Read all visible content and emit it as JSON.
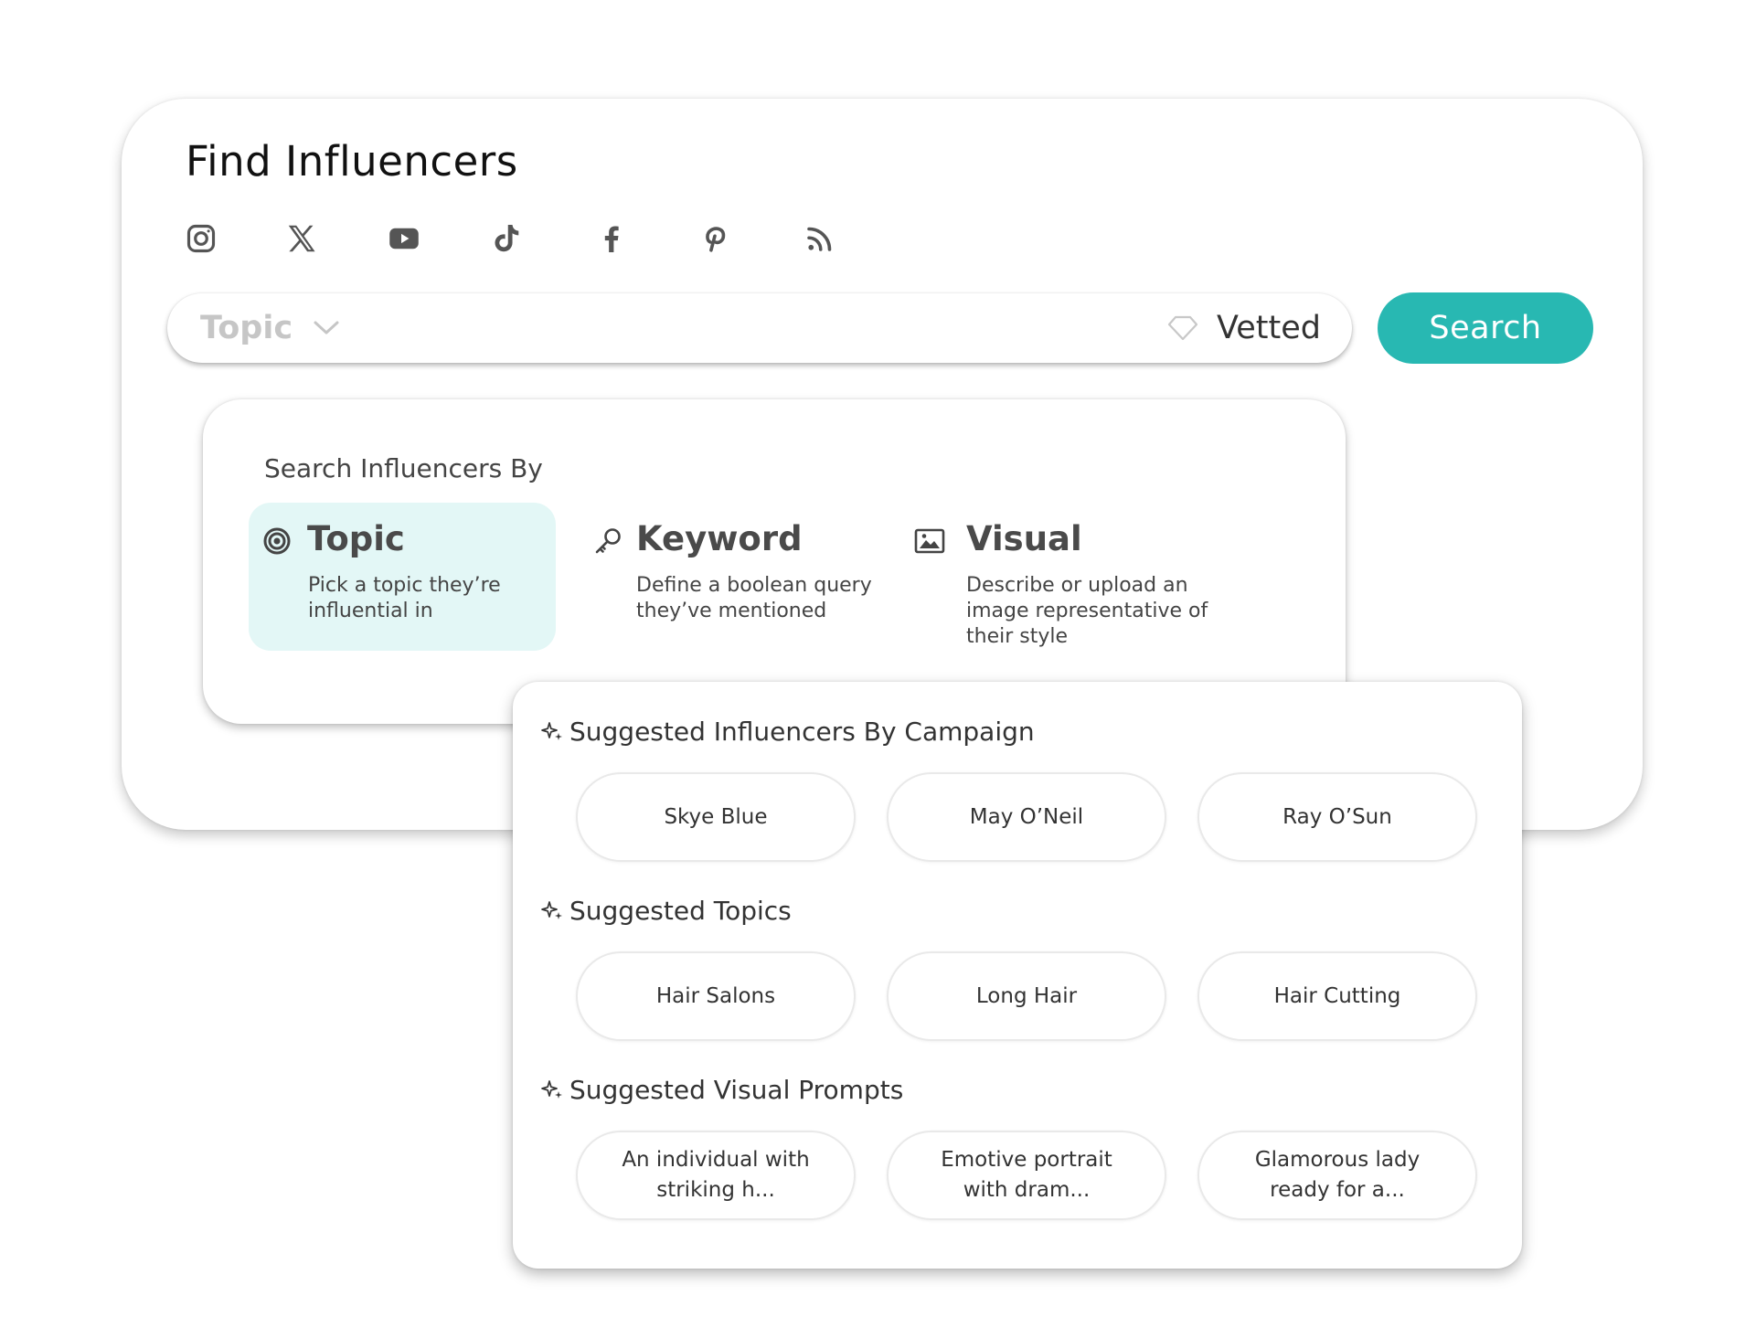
{
  "header": {
    "title": "Find Influencers"
  },
  "platforms": [
    {
      "name": "instagram-icon"
    },
    {
      "name": "x-icon"
    },
    {
      "name": "youtube-icon"
    },
    {
      "name": "tiktok-icon"
    },
    {
      "name": "facebook-icon"
    },
    {
      "name": "pinterest-icon"
    },
    {
      "name": "rss-icon"
    }
  ],
  "search": {
    "mode_label": "Topic",
    "vetted_label": "Vetted",
    "button_label": "Search"
  },
  "search_by": {
    "title": "Search Influencers By",
    "modes": [
      {
        "name": "Topic",
        "desc": "Pick a topic they’re influential in",
        "icon": "target-icon",
        "active": true
      },
      {
        "name": "Keyword",
        "desc": "Define a boolean query they’ve mentioned",
        "icon": "key-icon",
        "active": false
      },
      {
        "name": "Visual",
        "desc": "Describe or upload an image representative of their style",
        "icon": "image-icon",
        "active": false
      }
    ]
  },
  "suggestions": {
    "sections": [
      {
        "title": "Suggested Influencers By Campaign",
        "items": [
          "Skye Blue",
          "May O’Neil",
          "Ray O’Sun"
        ]
      },
      {
        "title": "Suggested Topics",
        "items": [
          "Hair Salons",
          "Long Hair",
          "Hair Cutting"
        ]
      },
      {
        "title": "Suggested Visual Prompts",
        "items": [
          "An individual with striking h...",
          "Emotive portrait with dram...",
          "Glamorous lady ready for a..."
        ]
      }
    ]
  },
  "colors": {
    "accent": "#28b8b2",
    "active_tile": "#e3f7f6",
    "icon": "#555555",
    "placeholder": "#c6c6c6"
  }
}
